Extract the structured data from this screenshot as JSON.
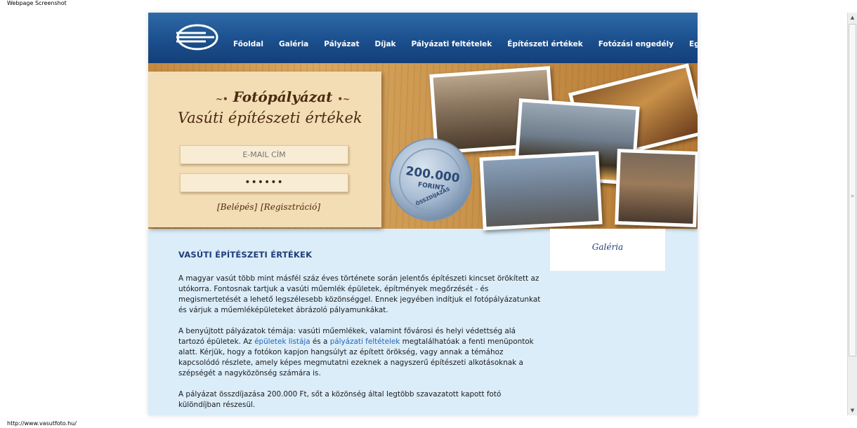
{
  "window": {
    "caption": "Webpage Screenshot",
    "status_url": "http://www.vasutfoto.hu/"
  },
  "nav": {
    "items": [
      {
        "label": "Főoldal"
      },
      {
        "label": "Galéria"
      },
      {
        "label": "Pályázat"
      },
      {
        "label": "Díjak"
      },
      {
        "label": "Pályázati feltételek"
      },
      {
        "label": "Építészeti értékek"
      },
      {
        "label": "Fotózási engedély"
      },
      {
        "label": "Együttműködés"
      }
    ]
  },
  "hero": {
    "title": "Fotópályázat",
    "subtitle": "Vasúti építészeti értékek",
    "email_placeholder": "E-MAIL CÍM",
    "password_value": "••••••",
    "login_label": "[Belépés]",
    "register_label": "[Regisztráció]",
    "seal": {
      "amount": "200.000",
      "unit": "FORINT",
      "caption": "ÖSSZDÍJAZÁS"
    }
  },
  "content": {
    "title": "VASÚTI ÉPÍTÉSZETI ÉRTÉKEK",
    "p1": "A magyar vasút több mint másfél száz éves története során jelentős építészeti kincset örökített az utókorra. Fontosnak tartjuk a vasúti műemlék épületek, építmények megőrzését - és megismertetését a lehető legszélesebb közönséggel. Ennek jegyében indítjuk el fotópályázatunkat és várjuk a műemléképületeket ábrázoló pályamunkákat.",
    "p2_before": "A benyújtott pályázatok témája: vasúti műemlékek, valamint fővárosi és helyi védettség alá tartozó épületek. Az ",
    "p2_link1": "épületek listája",
    "p2_middle": " és a ",
    "p2_link2": "pályázati feltételek",
    "p2_after": " megtalálhatóak a fenti menüpontok alatt. Kérjük, hogy a fotókon kapjon hangsúlyt az épített örökség, vagy annak a témához kapcsolódó részlete, amely képes megmutatni ezeknek a nagyszerű építészeti alkotásoknak a szépségét a nagyközönség számára is.",
    "p3": "A pályázat összdíjazása 200.000 Ft, sőt a közönség által legtöbb szavazatott kapott fotó különdíjban részesül."
  },
  "sidebar": {
    "gallery_label": "Galéria"
  },
  "colors": {
    "nav_blue": "#1b4f8d",
    "content_bg": "#dbedf9",
    "title_blue": "#1f3d7a",
    "link_blue": "#2365b8"
  }
}
